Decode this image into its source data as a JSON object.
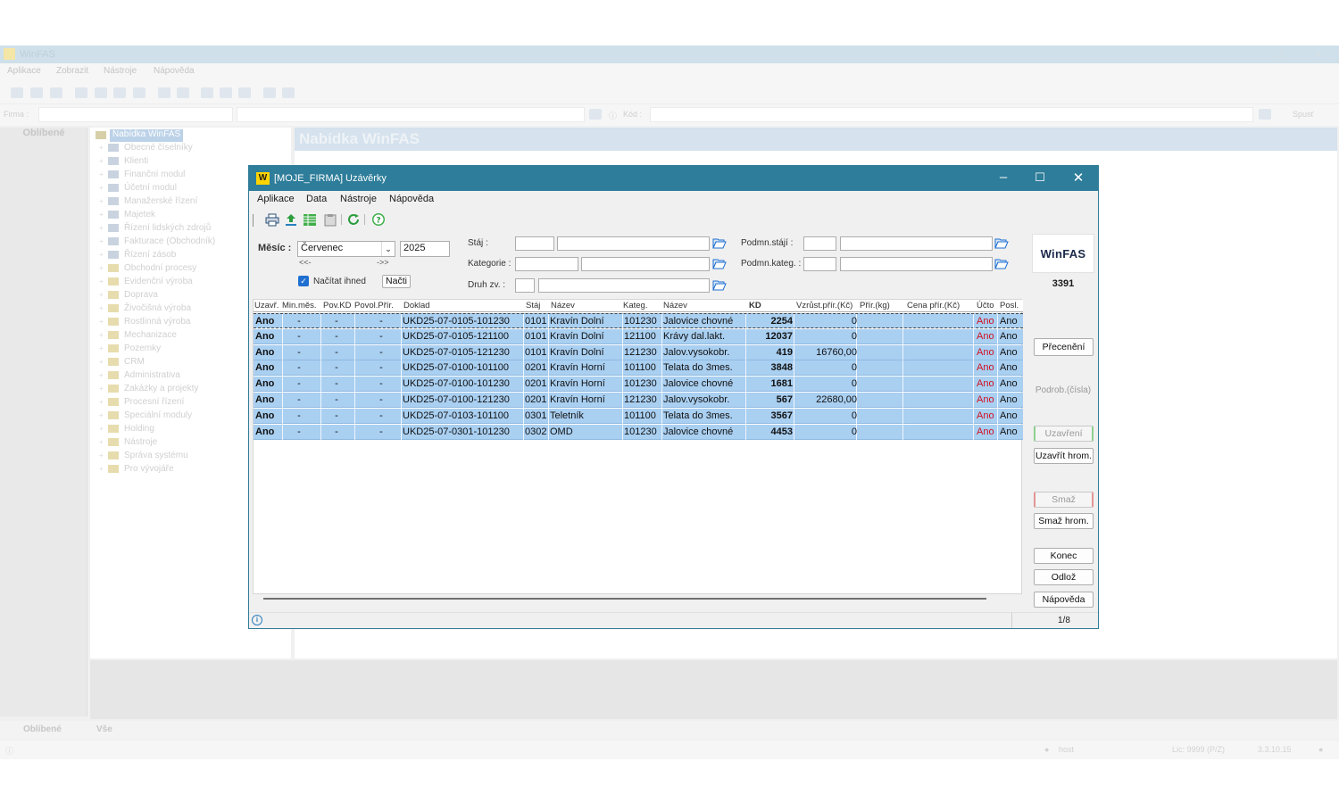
{
  "app": {
    "title": "WinFAS",
    "menu": [
      "Aplikace",
      "Zobrazit",
      "Nástroje",
      "Nápověda"
    ],
    "firm_label": "Firma :",
    "kod_label": "Kód :",
    "spust_label": "Spusť",
    "fav_header": "Oblíbené",
    "content_header": "Nabídka WinFAS",
    "tree_root": "Nabídka WinFAS",
    "tree_items": [
      "Obecné číselníky",
      "Klienti",
      "Finanční modul",
      "Účetní modul",
      "Manažerské řízení",
      "Majetek",
      "Řízení lidských zdrojů",
      "Fakturace (Obchodník)",
      "Řízení zásob",
      "Obchodní procesy",
      "Evidenční výroba",
      "Doprava",
      "Živočišná výroba",
      "Rostlinná výroba",
      "Mechanizace",
      "Pozemky",
      "CRM",
      "Administrativa",
      "Zakázky a projekty",
      "Procesní řízení",
      "Speciální moduly",
      "Holding",
      "Nástroje",
      "Správa systému",
      "Pro vývojáře"
    ],
    "bottom_tabs": [
      "Oblíbené",
      "Vše"
    ],
    "status": {
      "user": "host",
      "lic": "Lic: 9999 (P/Z)",
      "version": "3.3.10.15"
    }
  },
  "dialog": {
    "title": "[MOJE_FIRMA] Uzávěrky",
    "menu": [
      "Aplikace",
      "Data",
      "Nástroje",
      "Nápověda"
    ],
    "mesic_label": "Měsíc :",
    "mesic_value": "Červenec",
    "rok_value": "2025",
    "prev_label": "<<-",
    "next_label": "->>",
    "nacitat_label": "Načítat ihned",
    "nacti_label": "Načti",
    "staj_label": "Stáj :",
    "kategorie_label": "Kategorie :",
    "druh_label": "Druh zv. :",
    "podmn_staji_label": "Podmn.stájí :",
    "podmn_kateg_label": "Podmn.kateg. :",
    "logo_text": "WinFAS",
    "count": "3391",
    "buttons": {
      "preceneni": "Přecenění",
      "podrob": "Podrob.(čísla)",
      "uzavreni": "Uzavření",
      "uzavrit_hrom": "Uzavřít hrom.",
      "smaz": "Smaž",
      "smaz_hrom": "Smaž hrom.",
      "konec": "Konec",
      "odloz": "Odlož",
      "napoveda": "Nápověda"
    },
    "columns": [
      "Uzavř.",
      "Min.měs.",
      "Pov.KD",
      "Povol.Přír.",
      "Doklad",
      "Stáj",
      "Název",
      "Kateg.",
      "Název",
      "KD",
      "Vzrůst.přír.(Kč)",
      "Přír.(kg)",
      "Cena přír.(Kč)",
      "Účto",
      "Posl."
    ],
    "rows": [
      {
        "uzavr": "Ano",
        "min": "-",
        "pov": "-",
        "povol": "-",
        "doklad": "UKD25-07-0105-101230",
        "staj": "0101",
        "staj_nazev": "Kravín Dolní",
        "kateg": "101230",
        "kat_nazev": "Jalovice chovné",
        "kd": "2254",
        "vzrust": "0",
        "prir": "",
        "cena": "",
        "ucto": "Ano",
        "posl": "Ano"
      },
      {
        "uzavr": "Ano",
        "min": "-",
        "pov": "-",
        "povol": "-",
        "doklad": "UKD25-07-0105-121100",
        "staj": "0101",
        "staj_nazev": "Kravín Dolní",
        "kateg": "121100",
        "kat_nazev": "Krávy dal.lakt.",
        "kd": "12037",
        "vzrust": "0",
        "prir": "",
        "cena": "",
        "ucto": "Ano",
        "posl": "Ano"
      },
      {
        "uzavr": "Ano",
        "min": "-",
        "pov": "-",
        "povol": "-",
        "doklad": "UKD25-07-0105-121230",
        "staj": "0101",
        "staj_nazev": "Kravín Dolní",
        "kateg": "121230",
        "kat_nazev": "Jalov.vysokobr.",
        "kd": "419",
        "vzrust": "16760,00",
        "prir": "",
        "cena": "",
        "ucto": "Ano",
        "posl": "Ano"
      },
      {
        "uzavr": "Ano",
        "min": "-",
        "pov": "-",
        "povol": "-",
        "doklad": "UKD25-07-0100-101100",
        "staj": "0201",
        "staj_nazev": "Kravín Horní",
        "kateg": "101100",
        "kat_nazev": "Telata do 3mes.",
        "kd": "3848",
        "vzrust": "0",
        "prir": "",
        "cena": "",
        "ucto": "Ano",
        "posl": "Ano"
      },
      {
        "uzavr": "Ano",
        "min": "-",
        "pov": "-",
        "povol": "-",
        "doklad": "UKD25-07-0100-101230",
        "staj": "0201",
        "staj_nazev": "Kravín Horní",
        "kateg": "101230",
        "kat_nazev": "Jalovice chovné",
        "kd": "1681",
        "vzrust": "0",
        "prir": "",
        "cena": "",
        "ucto": "Ano",
        "posl": "Ano"
      },
      {
        "uzavr": "Ano",
        "min": "-",
        "pov": "-",
        "povol": "-",
        "doklad": "UKD25-07-0100-121230",
        "staj": "0201",
        "staj_nazev": "Kravín Horní",
        "kateg": "121230",
        "kat_nazev": "Jalov.vysokobr.",
        "kd": "567",
        "vzrust": "22680,00",
        "prir": "",
        "cena": "",
        "ucto": "Ano",
        "posl": "Ano"
      },
      {
        "uzavr": "Ano",
        "min": "-",
        "pov": "-",
        "povol": "-",
        "doklad": "UKD25-07-0103-101100",
        "staj": "0301",
        "staj_nazev": "Teletník",
        "kateg": "101100",
        "kat_nazev": "Telata do 3mes.",
        "kd": "3567",
        "vzrust": "0",
        "prir": "",
        "cena": "",
        "ucto": "Ano",
        "posl": "Ano"
      },
      {
        "uzavr": "Ano",
        "min": "-",
        "pov": "-",
        "povol": "-",
        "doklad": "UKD25-07-0301-101230",
        "staj": "0302",
        "staj_nazev": "OMD",
        "kateg": "101230",
        "kat_nazev": "Jalovice chovné",
        "kd": "4453",
        "vzrust": "0",
        "prir": "",
        "cena": "",
        "ucto": "Ano",
        "posl": "Ano"
      }
    ],
    "record_position": "1/8",
    "colors": {
      "title_bar": "#2e7d9a",
      "row_selected": "#a9cff1",
      "ucto_red": "#d01020"
    }
  }
}
